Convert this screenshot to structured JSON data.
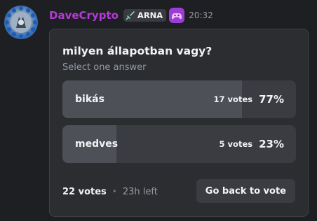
{
  "message": {
    "author": "DaveCrypto",
    "author_color": "#b43ad8",
    "tag_icon": "sword-icon",
    "tag_label": "ARNA",
    "badge_icon": "game-controller-icon",
    "badge_color": "#9b3dd6",
    "timestamp": "20:32"
  },
  "poll": {
    "question": "milyen állapotban vagy?",
    "instruction": "Select one answer",
    "answers": [
      {
        "label": "bikás",
        "votes": "17 votes",
        "percent": "77%",
        "fraction": 0.77
      },
      {
        "label": "medves",
        "votes": "5 votes",
        "percent": "23%",
        "fraction": 0.23
      }
    ],
    "total_votes": "22 votes",
    "separator": "•",
    "time_left": "23h left",
    "action_label": "Go back to vote"
  }
}
